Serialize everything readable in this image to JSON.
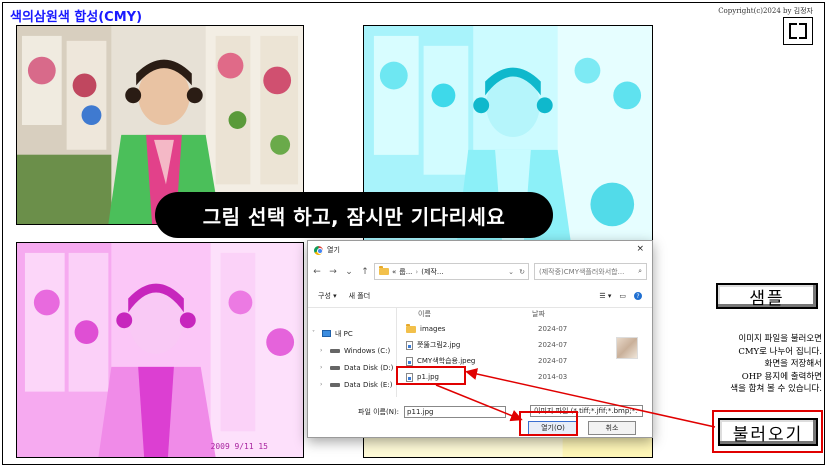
{
  "app": {
    "title": "색의삼원색 합성(CMY)",
    "copyright": "Copyright(c)2024 by 김정자"
  },
  "toast": "그림 선택 하고, 잠시만  기다리세요",
  "buttons": {
    "sample": "샘플",
    "load": "불러오기"
  },
  "info_lines": [
    "이미지 파일을 불러오면",
    "CMY로 나누어 집니다.",
    "화면을 저장해서",
    "OHP 용지에 출력하면",
    "색을 합쳐 볼 수 있습니다."
  ],
  "photo_stamp": "2009 9/11 15",
  "dialog": {
    "title": "열기",
    "close": "×",
    "path_prefix": "«",
    "path_parts": [
      "룹...",
      "(제작..."
    ],
    "search_placeholder": "(제작중)CMY색플러와서합...",
    "organize": "구성 ▾",
    "new_folder": "새 폴더",
    "help": "?",
    "col_name": "이름",
    "col_date": "날짜",
    "nav_items": [
      {
        "label": "내 PC",
        "icon": "pc-icon"
      },
      {
        "label": "Windows (C:)",
        "icon": "disk-icon"
      },
      {
        "label": "Data Disk (D:)",
        "icon": "disk-icon"
      },
      {
        "label": "Data Disk (E:)",
        "icon": "disk-icon"
      }
    ],
    "files": [
      {
        "name": "images",
        "date": "2024-07",
        "type": "folder"
      },
      {
        "name": "쯧뚫그림2.jpg",
        "date": "2024-07",
        "type": "file"
      },
      {
        "name": "CMY색학습용.jpeg",
        "date": "2024-07",
        "type": "file"
      },
      {
        "name": "p1.jpg",
        "date": "2014-03",
        "type": "file"
      }
    ],
    "filename_label": "파일 이름(N):",
    "filename_value": "p11.jpg",
    "filetype": "이미지 파일 (*.tiff;*.jfif;*.bmp;*.",
    "open_label": "열기(O)",
    "cancel_label": "취소"
  },
  "colors": {
    "title": "#1a1aff",
    "highlight": "#e00000",
    "cyan": "#00e5ff",
    "magenta": "#ff00ff",
    "yellow": "#ffff40"
  }
}
